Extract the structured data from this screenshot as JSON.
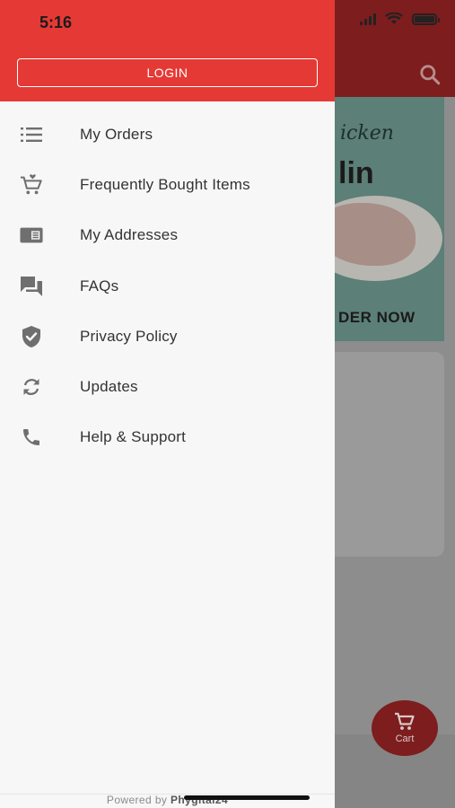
{
  "status_bar": {
    "time": "5:16"
  },
  "drawer": {
    "login_label": "LOGIN",
    "menu": [
      {
        "label": "My Orders",
        "icon": "list-icon"
      },
      {
        "label": "Frequently Bought Items",
        "icon": "cart-heart-icon"
      },
      {
        "label": "My Addresses",
        "icon": "address-card-icon"
      },
      {
        "label": "FAQs",
        "icon": "chat-bubbles-icon"
      },
      {
        "label": "Privacy Policy",
        "icon": "shield-check-icon"
      },
      {
        "label": "Updates",
        "icon": "sync-icon"
      },
      {
        "label": "Help & Support",
        "icon": "phone-icon"
      }
    ],
    "powered_prefix": "Powered by",
    "powered_brand": "Phygital24"
  },
  "background": {
    "banner_script": "icken",
    "banner_big": "lin",
    "banner_cta": "DER NOW",
    "cart_label": "Cart"
  },
  "colors": {
    "drawer_header": "#e53935",
    "app_header_dimmed": "#7d1d1e",
    "menu_text": "#333333",
    "icon_gray": "#6f6f6f"
  }
}
